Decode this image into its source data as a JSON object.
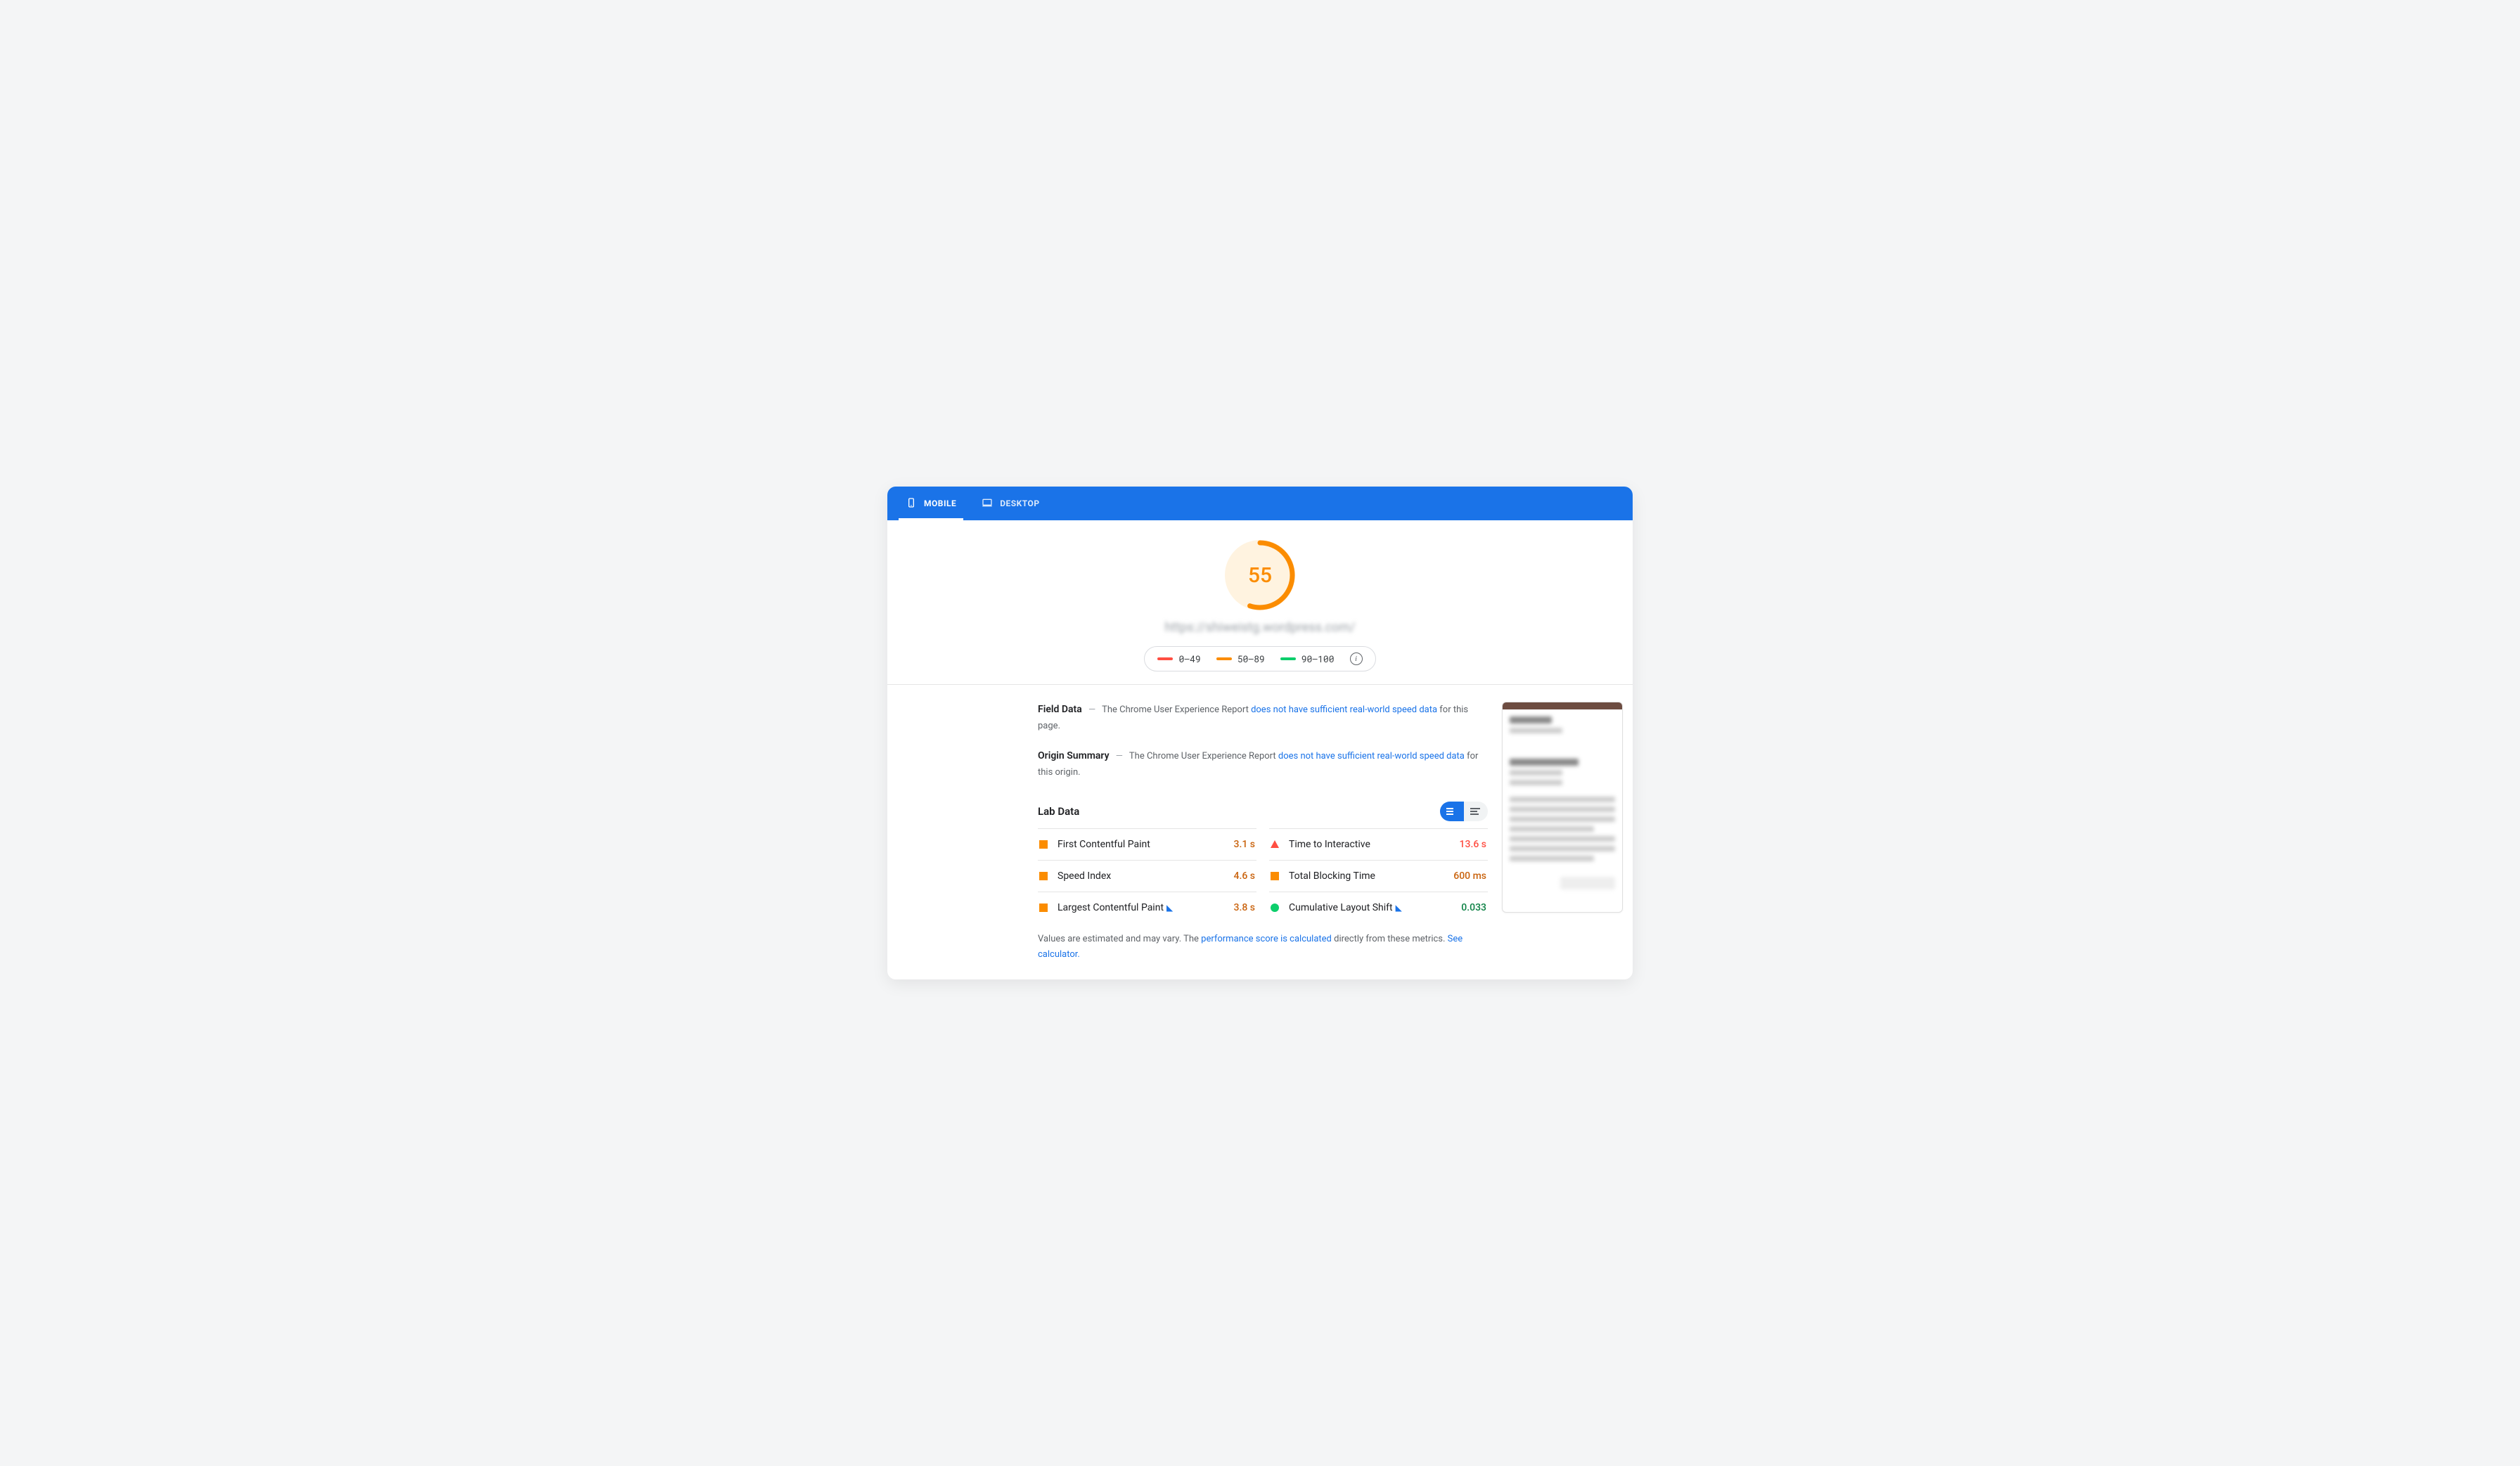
{
  "tabs": {
    "mobile": "MOBILE",
    "desktop": "DESKTOP"
  },
  "score": 55,
  "url": "https://shiweistg.wordpress.com/",
  "legend": {
    "low": "0–49",
    "mid": "50–89",
    "high": "90–100"
  },
  "colors": {
    "red": "#ff4e42",
    "orange": "#fb8c00",
    "green": "#0cce6b"
  },
  "field_data": {
    "heading": "Field Data",
    "prefix": "The Chrome User Experience Report ",
    "link": "does not have sufficient real-world speed data",
    "suffix": " for this page."
  },
  "origin_summary": {
    "heading": "Origin Summary",
    "prefix": "The Chrome User Experience Report ",
    "link": "does not have sufficient real-world speed data",
    "suffix": " for this origin."
  },
  "lab_heading": "Lab Data",
  "metrics": {
    "fcp": {
      "name": "First Contentful Paint",
      "value": "3.1 s"
    },
    "tti": {
      "name": "Time to Interactive",
      "value": "13.6 s"
    },
    "si": {
      "name": "Speed Index",
      "value": "4.6 s"
    },
    "tbt": {
      "name": "Total Blocking Time",
      "value": "600 ms"
    },
    "lcp": {
      "name": "Largest Contentful Paint",
      "value": "3.8 s"
    },
    "cls": {
      "name": "Cumulative Layout Shift",
      "value": "0.033"
    }
  },
  "footer": {
    "p1": "Values are estimated and may vary. The ",
    "link1": "performance score is calculated",
    "p2": " directly from these metrics. ",
    "link2": "See calculator."
  }
}
